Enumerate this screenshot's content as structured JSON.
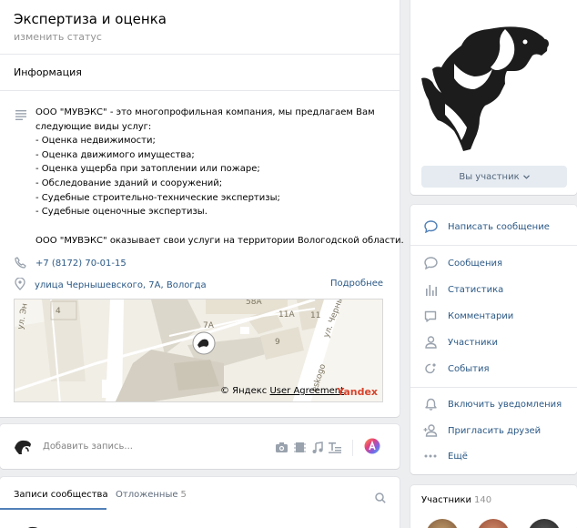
{
  "header": {
    "title": "Экспертиза и оценка",
    "status_placeholder": "изменить статус"
  },
  "info": {
    "section_label": "Информация",
    "description_lines": [
      "ООО \"МУВЭКС\" - это многопрофильная компания, мы предлагаем Вам",
      "следующие виды услуг:",
      "- Оценка недвижимости;",
      "- Оценка движимого имущества;",
      "- Оценка ущерба при затоплении или пожаре;",
      "- Обследование зданий и сооружений;",
      "- Судебные строительно-технические экспертизы;",
      "- Судебные оценочные экспертизы."
    ],
    "description_footer": "ООО \"МУВЭКС\" оказывает свои услуги на территории Вологодской области.",
    "phone": "+7 (8172) 70-01-15",
    "address": "улица Чернышевского, 7А, Вологда",
    "more_link": "Подробнее"
  },
  "map": {
    "labels": [
      "4",
      "58А",
      "7А",
      "11А",
      "11",
      "9",
      "ул. Черны",
      "ул. Эн",
      "eskogo"
    ],
    "copyright": "© Яндекс",
    "user_agreement": "User Agreement",
    "brand": "Yandex"
  },
  "post_box": {
    "placeholder": "Добавить запись..."
  },
  "tabs": {
    "active": "Записи сообщества",
    "other": "Отложенные",
    "other_count": "5"
  },
  "cover": {
    "member_button": "Вы участник"
  },
  "menu": {
    "send_message": "Написать сообщение",
    "items": [
      "Сообщения",
      "Статистика",
      "Комментарии",
      "Участники",
      "События"
    ],
    "actions": [
      "Включить уведомления",
      "Пригласить друзей",
      "Ещё"
    ]
  },
  "members": {
    "title": "Участники",
    "count": "140"
  },
  "colors": {
    "link": "#2a5885",
    "accent": "#5181b8",
    "background": "#edeef0"
  }
}
